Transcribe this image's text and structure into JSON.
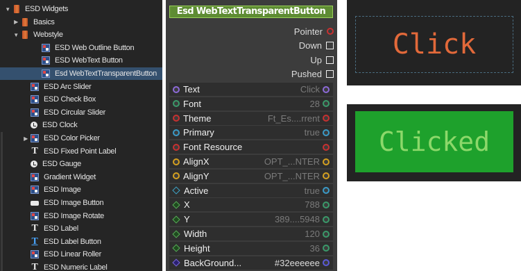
{
  "tree": {
    "items": [
      {
        "label": "ESD Widgets",
        "icon": "folder-icon",
        "arrow": "▼"
      },
      {
        "label": "Basics",
        "icon": "folder-icon",
        "arrow": "▶"
      },
      {
        "label": "Webstyle",
        "icon": "folder-icon",
        "arrow": "▼"
      },
      {
        "label": "ESD Web Outline Button",
        "icon": "widget-icon"
      },
      {
        "label": "ESD WebText Button",
        "icon": "widget-icon"
      },
      {
        "label": "Esd WebTextTransparentButton",
        "icon": "widget-icon",
        "selected": true
      },
      {
        "label": "ESD Arc Slider",
        "icon": "widget-icon"
      },
      {
        "label": "ESD Check Box",
        "icon": "widget-icon"
      },
      {
        "label": "ESD Circular Slider",
        "icon": "widget-icon"
      },
      {
        "label": "ESD Clock",
        "icon": "clock-icon"
      },
      {
        "label": "ESD Color Picker",
        "icon": "widget-icon",
        "arrow": "▶"
      },
      {
        "label": "ESD Fixed Point Label",
        "icon": "text-label-icon"
      },
      {
        "label": "ESD Gauge",
        "icon": "clock-icon"
      },
      {
        "label": "Gradient Widget",
        "icon": "widget-icon"
      },
      {
        "label": "ESD Image",
        "icon": "widget-icon"
      },
      {
        "label": "ESD Image Button",
        "icon": "image-button-icon"
      },
      {
        "label": "ESD Image Rotate",
        "icon": "widget-icon"
      },
      {
        "label": "ESD Label",
        "icon": "text-label-icon"
      },
      {
        "label": "ESD Label Button",
        "icon": "text-label-button-icon"
      },
      {
        "label": "ESD Linear Roller",
        "icon": "widget-icon"
      },
      {
        "label": "ESD Numeric Label",
        "icon": "text-label-icon"
      }
    ]
  },
  "node": {
    "title": "Esd WebTextTransparentButton",
    "outputs": [
      {
        "label": "Pointer",
        "kind": "pin"
      },
      {
        "label": "Down",
        "kind": "checkbox"
      },
      {
        "label": "Up",
        "kind": "checkbox"
      },
      {
        "label": "Pushed",
        "kind": "checkbox"
      }
    ],
    "properties": [
      {
        "name": "Text",
        "value": "Click",
        "pin": "circle",
        "color": "#8c6ad8"
      },
      {
        "name": "Font",
        "value": "28",
        "pin": "circle",
        "color": "#3a9a6a"
      },
      {
        "name": "Theme",
        "value": "Ft_Es....rrent",
        "pin": "circle",
        "color": "#c83030"
      },
      {
        "name": "Primary",
        "value": "true",
        "pin": "circle",
        "color": "#3a9ac8"
      },
      {
        "name": "Font Resource",
        "value": "",
        "pin": "circle",
        "color": "#c83030"
      },
      {
        "name": "AlignX",
        "value": "OPT_...NTER",
        "pin": "circle",
        "color": "#d4a020"
      },
      {
        "name": "AlignY",
        "value": "OPT_...NTER",
        "pin": "circle",
        "color": "#d4a020"
      },
      {
        "name": "Active",
        "value": "true",
        "pin": "diamond",
        "color": "#3ea4c8"
      },
      {
        "name": "X",
        "value": "788",
        "pin": "diamond-green",
        "color": "#5aaa5a"
      },
      {
        "name": "Y",
        "value": "389....5948",
        "pin": "diamond-green",
        "color": "#5aaa5a"
      },
      {
        "name": "Width",
        "value": "120",
        "pin": "diamond-green",
        "color": "#5aaa5a"
      },
      {
        "name": "Height",
        "value": "36",
        "pin": "diamond-green",
        "color": "#5aaa5a"
      },
      {
        "name": "BackGround...",
        "value": "#32eeeeee",
        "pin": "diamond-violet",
        "color": "#5a5ad8",
        "bright": true
      }
    ]
  },
  "preview": {
    "normal_label": "Click",
    "clicked_label": "Clicked"
  }
}
